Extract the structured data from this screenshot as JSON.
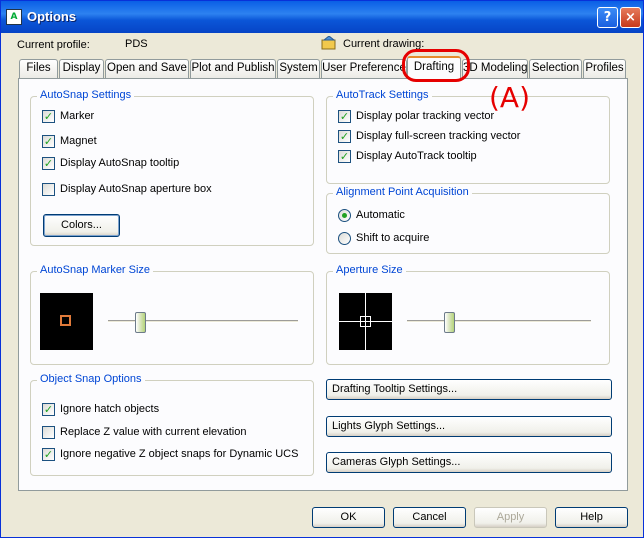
{
  "window": {
    "title": "Options",
    "help_glyph": "?",
    "close_glyph": "×",
    "app_icon_glyph": "A"
  },
  "profile": {
    "label": "Current profile:",
    "value": "PDS"
  },
  "drawing": {
    "label": "Current drawing:"
  },
  "tabs": [
    {
      "label": "Files"
    },
    {
      "label": "Display"
    },
    {
      "label": "Open and Save"
    },
    {
      "label": "Plot and Publish"
    },
    {
      "label": "System"
    },
    {
      "label": "User Preference"
    },
    {
      "label": "Drafting"
    },
    {
      "label": "3D Modeling"
    },
    {
      "label": "Selection"
    },
    {
      "label": "Profiles"
    }
  ],
  "autosnap_settings": {
    "title": "AutoSnap Settings",
    "options": [
      {
        "label": "Marker",
        "checked": true
      },
      {
        "label": "Magnet",
        "checked": true
      },
      {
        "label": "Display AutoSnap tooltip",
        "checked": true
      },
      {
        "label": "Display AutoSnap aperture box",
        "checked": false
      }
    ],
    "colors_button": "Colors..."
  },
  "autotrack_settings": {
    "title": "AutoTrack Settings",
    "options": [
      {
        "label": "Display polar tracking vector",
        "checked": true
      },
      {
        "label": "Display full-screen tracking vector",
        "checked": true
      },
      {
        "label": "Display AutoTrack tooltip",
        "checked": true
      }
    ]
  },
  "alignment": {
    "title": "Alignment Point Acquisition",
    "options": [
      {
        "label": "Automatic",
        "selected": true
      },
      {
        "label": "Shift to acquire",
        "selected": false
      }
    ]
  },
  "marker_size": {
    "title": "AutoSnap Marker Size",
    "level": 0.17
  },
  "aperture_size": {
    "title": "Aperture Size",
    "level": 0.23
  },
  "object_snap": {
    "title": "Object Snap Options",
    "options": [
      {
        "label": "Ignore hatch objects",
        "checked": true
      },
      {
        "label": "Replace Z value with current elevation",
        "checked": false
      },
      {
        "label": "Ignore negative Z object snaps for Dynamic UCS",
        "checked": true
      }
    ]
  },
  "right_buttons": [
    {
      "label": "Drafting Tooltip Settings..."
    },
    {
      "label": "Lights Glyph Settings..."
    },
    {
      "label": "Cameras Glyph Settings..."
    }
  ],
  "footer": {
    "ok": "OK",
    "cancel": "Cancel",
    "apply": "Apply",
    "help": "Help"
  },
  "annotation": {
    "text": "(A)"
  },
  "colors": {
    "accent": "#0046d5",
    "annotation": "#e60000",
    "check": "#21a121"
  }
}
